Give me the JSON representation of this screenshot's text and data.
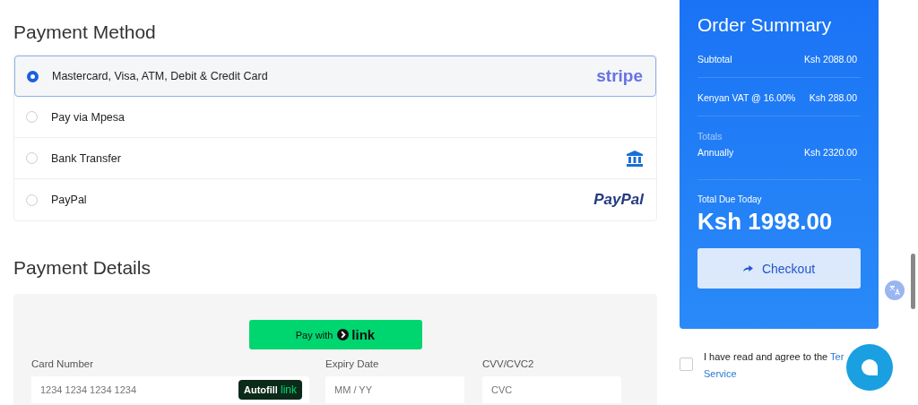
{
  "payment_method": {
    "title": "Payment Method",
    "options": [
      {
        "label": "Mastercard, Visa, ATM, Debit & Credit Card",
        "selected": true,
        "kind": "stripe",
        "logo_text": "stripe"
      },
      {
        "label": "Pay via Mpesa",
        "selected": false,
        "kind": "none"
      },
      {
        "label": "Bank Transfer",
        "selected": false,
        "kind": "bank"
      },
      {
        "label": "PayPal",
        "selected": false,
        "kind": "paypal",
        "logo_text": "PayPal"
      }
    ]
  },
  "payment_details": {
    "title": "Payment Details",
    "link_button": {
      "text": "Pay with",
      "brand": "link"
    },
    "fields": [
      {
        "label": "Card Number",
        "placeholder": "1234 1234 1234 1234",
        "kind": "card",
        "autofill": {
          "text": "Autofill",
          "brand": "link"
        }
      },
      {
        "label": "Expiry Date",
        "placeholder": "MM / YY",
        "kind": "plain"
      },
      {
        "label": "CVV/CVC2",
        "placeholder": "CVC",
        "kind": "plain"
      }
    ]
  },
  "order_summary": {
    "title": "Order Summary",
    "rows": [
      {
        "kind": "line",
        "label": "Subtotal",
        "amount": "Ksh 2088.00"
      },
      {
        "kind": "line",
        "label": "Kenyan VAT @ 16.00%",
        "amount": "Ksh 288.00"
      },
      {
        "kind": "group",
        "heading": "Totals",
        "label": "Annually",
        "amount": "Ksh 2320.00"
      }
    ],
    "due_label": "Total Due Today",
    "due_amount": "Ksh 1998.00",
    "checkout": "Checkout"
  },
  "terms": {
    "checked": false,
    "text": "I have read and agree to the",
    "link_parts": [
      "Ter",
      "Service"
    ]
  }
}
